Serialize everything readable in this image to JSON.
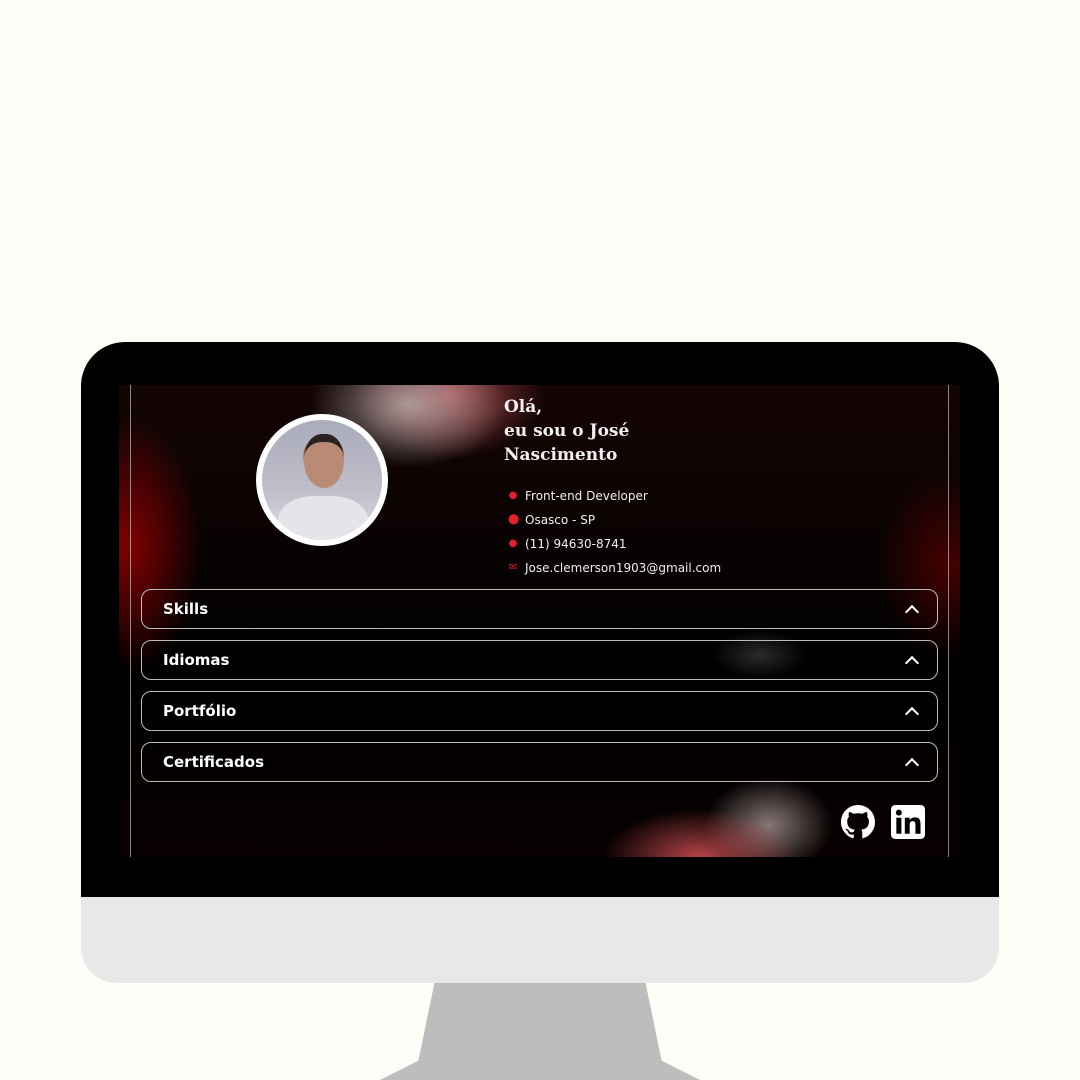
{
  "profile": {
    "greeting": "Olá,",
    "line2": "eu sou o José",
    "line3": "Nascimento"
  },
  "info": [
    {
      "icon": "user-icon",
      "text": "Front-end Developer"
    },
    {
      "icon": "map-pin-icon",
      "text": "Osasco - SP"
    },
    {
      "icon": "whatsapp-icon",
      "text": "(11) 94630-8741"
    },
    {
      "icon": "mail-icon",
      "text": "Jose.clemerson1903@gmail.com"
    }
  ],
  "sections": [
    "Skills",
    "Idiomas",
    "Portfólio",
    "Certificados"
  ],
  "social": [
    "github-icon",
    "linkedin-icon"
  ],
  "colors": {
    "accent": "#e0202a",
    "page": "#fdfcf7"
  }
}
